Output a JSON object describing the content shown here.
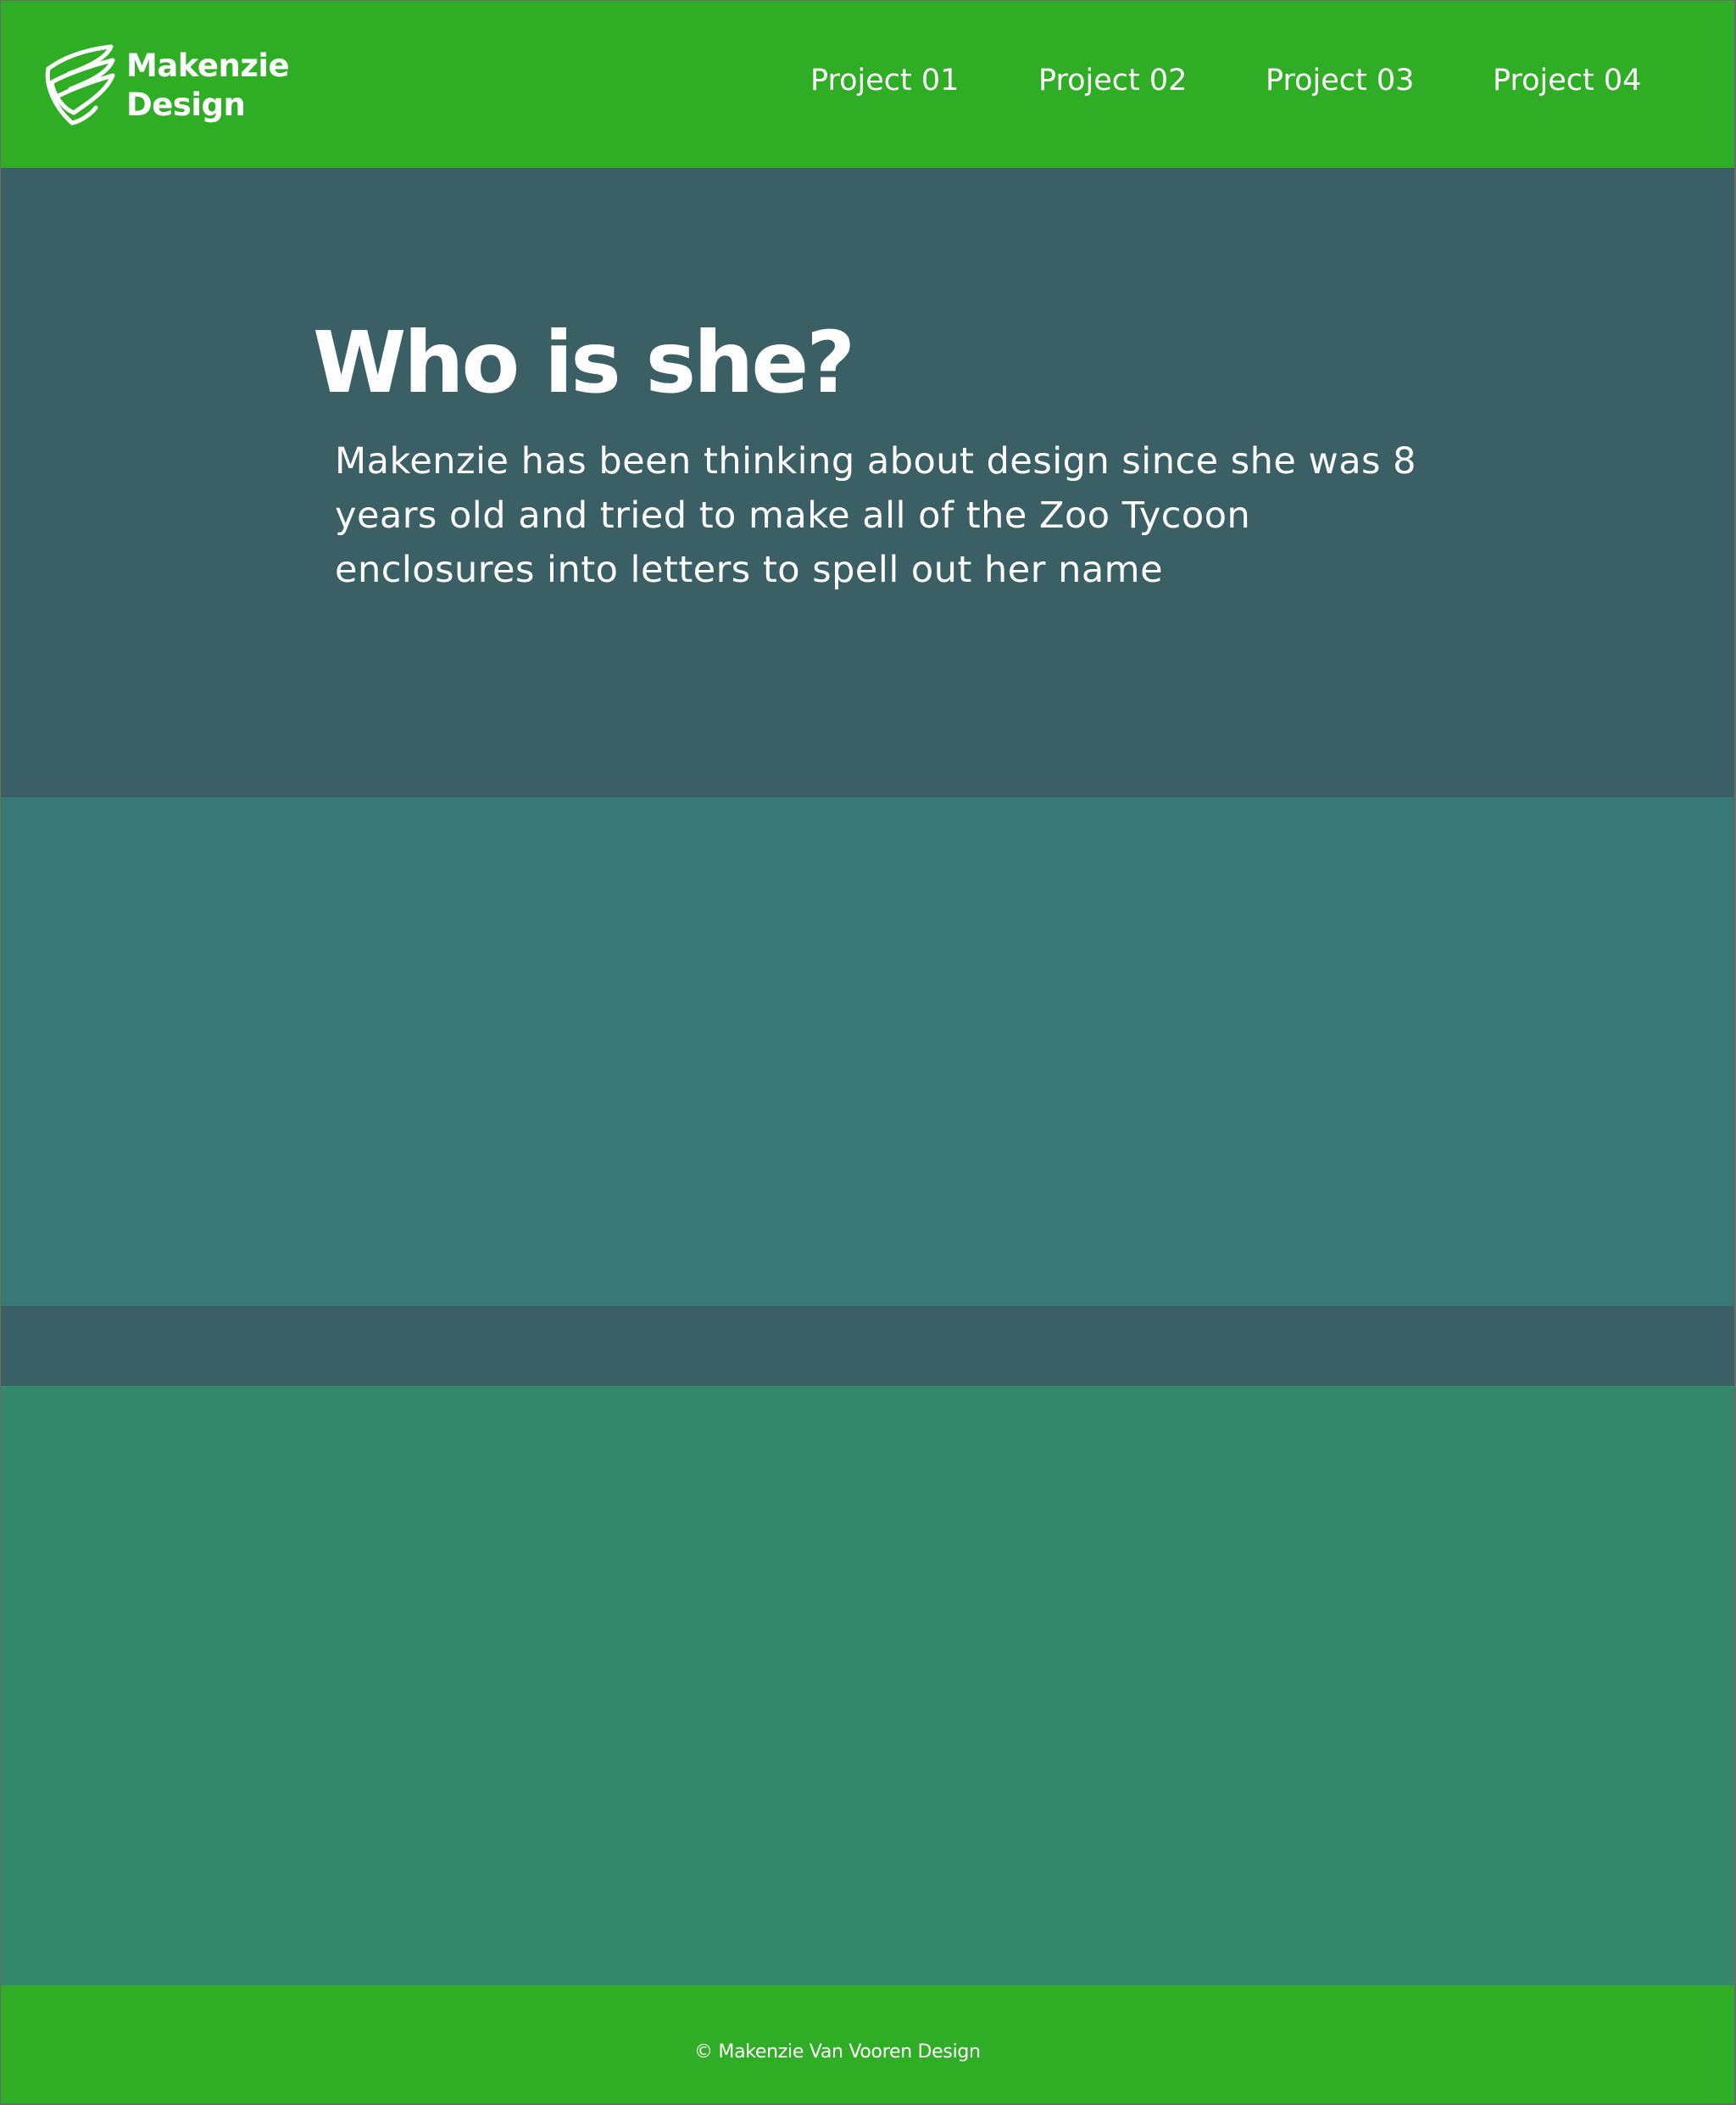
{
  "header": {
    "brand_line1": "Makenzie",
    "brand_line2": "Design",
    "logo_icon": "wing-logo-icon",
    "nav": [
      {
        "label": "Project 01"
      },
      {
        "label": "Project 02"
      },
      {
        "label": "Project 03"
      },
      {
        "label": "Project 04"
      }
    ]
  },
  "about": {
    "title": "Who is she?",
    "body": "Makenzie has been thinking about design since she was 8 years old and tried to make all of the Zoo Tycoon enclosures into letters to spell out her name"
  },
  "footer": {
    "copyright": "© Makenzie Van Vooren Design"
  },
  "colors": {
    "header_green": "#2fad25",
    "slate": "#3a6066",
    "teal": "#387875",
    "sea_green": "#34886c",
    "text": "#ffffff"
  }
}
